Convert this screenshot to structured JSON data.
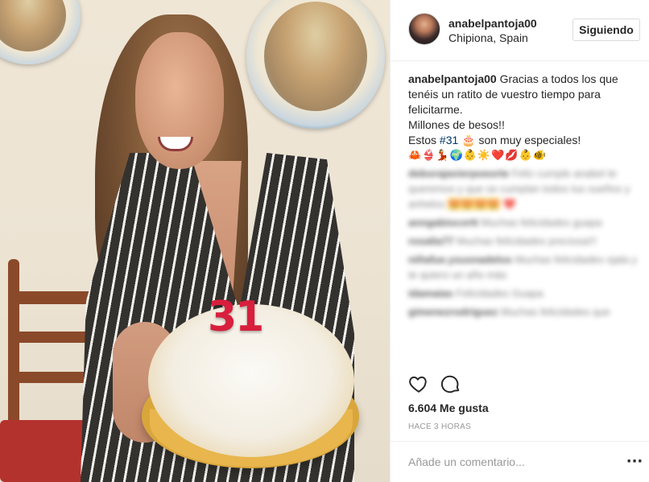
{
  "post": {
    "username": "anabelpantoja00",
    "location": "Chipiona, Spain",
    "follow_label": "Siguiendo"
  },
  "caption": {
    "user": "anabelpantoja00",
    "line1": "Gracias a todos los que",
    "line2": "tenéis un ratito de vuestro tiempo para",
    "line3": "felicitarme.",
    "line4": "Millones de besos!!",
    "line5_prefix": "Estos ",
    "hashtag": "#31",
    "line5_suffix": " 🎂 son muy especiales!",
    "emojis": "🦀👙💃🌍👶☀️❤️💋👶🐠"
  },
  "photo": {
    "candle_number": "31"
  },
  "blurred_comments": [
    {
      "user": "deborajavierpoeorte",
      "text": "Feliz cumple anabel te queremos y que se cumplan todos tus sueños y anhelos",
      "highlight": "😍😍😍😍",
      "heart": "❤️"
    },
    {
      "user": "anngabiocortt",
      "text": "Muchas felicidades guapa"
    },
    {
      "user": "rosalia77",
      "text": "Muchas felicidades preciosa!!!"
    },
    {
      "user": "niñafue.ysusnadelos",
      "text": "Muchas felicidades ojala y te quiero un año más"
    },
    {
      "user": "idamaias",
      "text": "Felicidades Guapa"
    },
    {
      "user": "gimenezrodriguez",
      "text": "Muchas felicidades que"
    }
  ],
  "actions": {
    "like_icon": "heart-outline-icon",
    "comment_icon": "speech-bubble-icon"
  },
  "likes": "6.604 Me gusta",
  "time_ago": "HACE 3 HORAS",
  "comment_box": {
    "placeholder": "Añade un comentario...",
    "more_icon": "ellipsis-icon",
    "more_glyph": "···"
  }
}
